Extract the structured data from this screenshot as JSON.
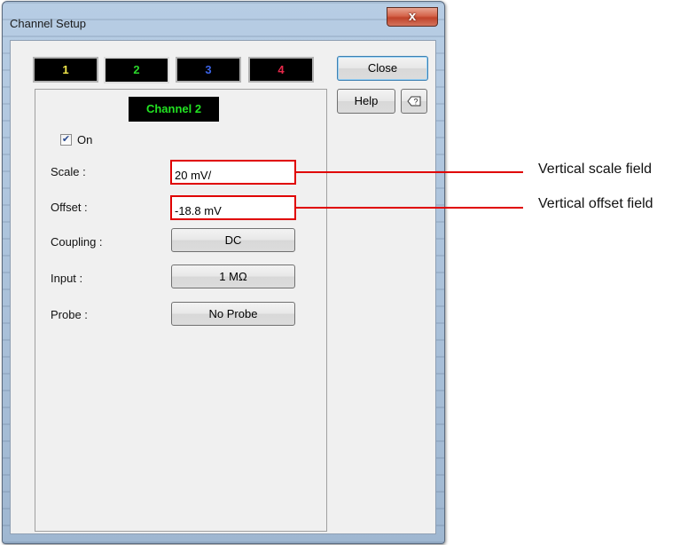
{
  "window": {
    "title": "Channel Setup",
    "close_glyph": "x"
  },
  "tabs": [
    {
      "label": "1",
      "color": "#f0e64a"
    },
    {
      "label": "2",
      "color": "#2bd62b"
    },
    {
      "label": "3",
      "color": "#3b63e6"
    },
    {
      "label": "4",
      "color": "#e8284a"
    }
  ],
  "channel": {
    "heading": "Channel 2",
    "on_label": "On",
    "on_checked": true
  },
  "fields": {
    "scale_label": "Scale :",
    "scale_value": "20 mV/",
    "offset_label": "Offset :",
    "offset_value": "-18.8 mV",
    "coupling_label": "Coupling :",
    "coupling_value": "DC",
    "input_label": "Input :",
    "input_value": "1 MΩ",
    "probe_label": "Probe :",
    "probe_value": "No Probe"
  },
  "side_buttons": {
    "close": "Close",
    "help": "Help",
    "context_help_icon": "context-help-icon"
  },
  "callouts": {
    "scale": "Vertical scale field",
    "offset": "Vertical offset field"
  },
  "colors": {
    "highlight": "#e00000",
    "channel_text": "#22e322"
  }
}
